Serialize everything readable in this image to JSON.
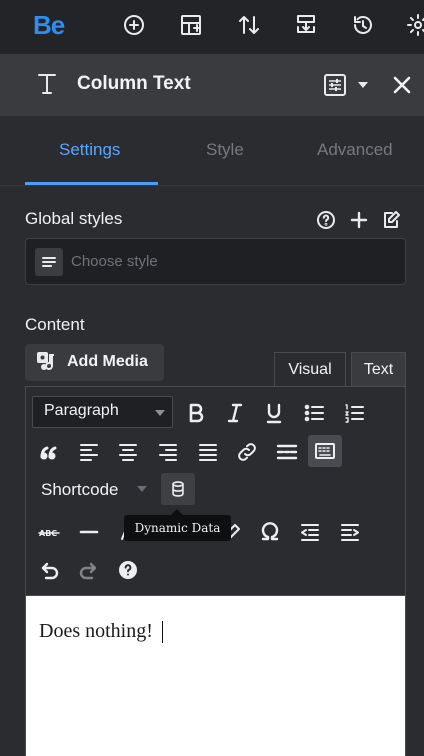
{
  "topbar": {
    "logo": "Be",
    "icons": [
      "add-circle-icon",
      "add-section-icon",
      "sort-icon",
      "import-export-icon",
      "history-icon",
      "gear-icon"
    ]
  },
  "panel": {
    "title": "Column Text",
    "title_icon": "text-t-icon",
    "settings_icon": "sliders-icon",
    "close_icon": "close-icon"
  },
  "tabs": [
    {
      "label": "Settings",
      "active": true
    },
    {
      "label": "Style",
      "active": false
    },
    {
      "label": "Advanced",
      "active": false
    }
  ],
  "global_styles": {
    "label": "Global styles",
    "placeholder": "Choose style",
    "icons": [
      "help-icon",
      "plus-icon",
      "edit-icon"
    ]
  },
  "content": {
    "label": "Content",
    "add_media": "Add Media",
    "mode_visual": "Visual",
    "mode_text": "Text"
  },
  "editor": {
    "format_select": "Paragraph",
    "shortcode_select": "Shortcode",
    "tooltip": "Dynamic Data",
    "row1_icons": [
      "bold-icon",
      "italic-icon",
      "underline-icon",
      "bullet-list-icon",
      "numbered-list-icon"
    ],
    "row2_icons": [
      "blockquote-icon",
      "align-left-icon",
      "align-center-icon",
      "align-right-icon",
      "justify-icon",
      "link-icon",
      "read-more-icon",
      "toolbar-toggle-icon"
    ],
    "row4_icons": [
      "strikethrough-icon",
      "horizontal-line-icon",
      "text-color-icon",
      "paste-text-icon",
      "clear-format-icon",
      "special-char-icon",
      "outdent-icon",
      "indent-icon"
    ],
    "row5_icons": [
      "undo-icon",
      "redo-icon",
      "help-icon"
    ],
    "body_text": "Does nothing!"
  },
  "colors": {
    "accent": "#4c9df8",
    "logo": "#2f8df2",
    "background": "#2b2c2f"
  }
}
